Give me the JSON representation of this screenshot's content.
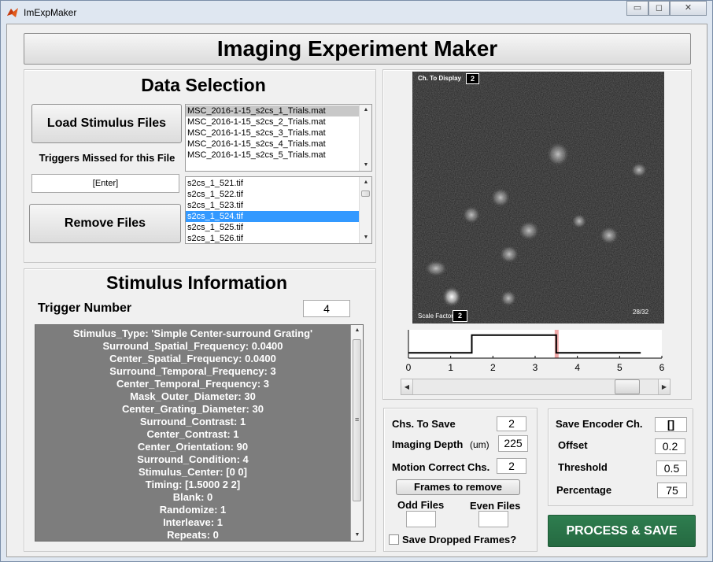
{
  "window": {
    "title": "ImExpMaker",
    "controls": {
      "minimize": "▭",
      "maximize": "◻",
      "close": "✕"
    }
  },
  "header": {
    "title": "Imaging Experiment Maker"
  },
  "data_selection": {
    "title": "Data Selection",
    "load_button": "Load Stimulus Files",
    "triggers_missed_label": "Triggers Missed for this File",
    "triggers_missed_value": "[Enter]",
    "remove_button": "Remove Files",
    "stimulus_files": [
      "MSC_2016-1-15_s2cs_1_Trials.mat",
      "MSC_2016-1-15_s2cs_2_Trials.mat",
      "MSC_2016-1-15_s2cs_3_Trials.mat",
      "MSC_2016-1-15_s2cs_4_Trials.mat",
      "MSC_2016-1-15_s2cs_5_Trials.mat"
    ],
    "stimulus_files_selected": 0,
    "tif_files": [
      "s2cs_1_521.tif",
      "s2cs_1_522.tif",
      "s2cs_1_523.tif",
      "s2cs_1_524.tif",
      "s2cs_1_525.tif",
      "s2cs_1_526.tif"
    ],
    "tif_files_selected": 3
  },
  "stimulus_info": {
    "title": "Stimulus Information",
    "trigger_label": "Trigger Number",
    "trigger_value": "4",
    "lines": [
      "Stimulus_Type: 'Simple Center-surround Grating'",
      "Surround_Spatial_Frequency: 0.0400",
      "Center_Spatial_Frequency: 0.0400",
      "Surround_Temporal_Frequency: 3",
      "Center_Temporal_Frequency: 3",
      "Mask_Outer_Diameter: 30",
      "Center_Grating_Diameter: 30",
      "Surround_Contrast: 1",
      "Center_Contrast: 1",
      "Center_Orientation: 90",
      "Surround_Condition: 4",
      "Stimulus_Center: [0 0]",
      "Timing: [1.5000 2 2]",
      "Blank: 0",
      "Randomize: 1",
      "Interleave: 1",
      "Repeats: 0"
    ]
  },
  "image_viewer": {
    "channel_label": "Ch. To Display",
    "channel_value": "2",
    "scale_label": "Scale Factor",
    "scale_value": "2",
    "frame_counter": "28/32"
  },
  "trigger_plot": {
    "x_ticks": [
      "0",
      "1",
      "2",
      "3",
      "4",
      "5",
      "6"
    ]
  },
  "chart_data": {
    "type": "line",
    "x": [
      0,
      1.5,
      1.5,
      3.5,
      3.5,
      5.5
    ],
    "y": [
      0,
      0,
      1,
      1,
      0,
      0
    ],
    "xlim": [
      0,
      6
    ],
    "ylim": [
      -0.3,
      1.3
    ],
    "xticks": [
      0,
      1,
      2,
      3,
      4,
      5,
      6
    ],
    "marker_x": 3.5,
    "line_color": "#000000",
    "marker_color": "#f2aaaa"
  },
  "slider": {
    "value_fraction": 0.91
  },
  "save_settings": {
    "chs_to_save_label": "Chs. To Save",
    "chs_to_save_value": "2",
    "imaging_depth_label": "Imaging Depth",
    "imaging_depth_unit": "(um)",
    "imaging_depth_value": "225",
    "motion_correct_label": "Motion Correct Chs.",
    "motion_correct_value": "2",
    "frames_button": "Frames to remove",
    "odd_files_label": "Odd Files",
    "odd_files_value": "",
    "even_files_label": "Even Files",
    "even_files_value": "",
    "save_dropped_label": "Save Dropped Frames?",
    "save_dropped_checked": false
  },
  "encoder": {
    "save_encoder_label": "Save Encoder Ch.",
    "save_encoder_value": "[]",
    "offset_label": "Offset",
    "offset_value": "0.2",
    "threshold_label": "Threshold",
    "threshold_value": "0.5",
    "percentage_label": "Percentage",
    "percentage_value": "75"
  },
  "process_button": "PROCESS & SAVE",
  "colors": {
    "process_button": "#2e7d4f",
    "selection_highlight": "#3399ff",
    "stimulus_panel_bg": "#7d7d7d",
    "image_bg": "#1e1e1e"
  }
}
